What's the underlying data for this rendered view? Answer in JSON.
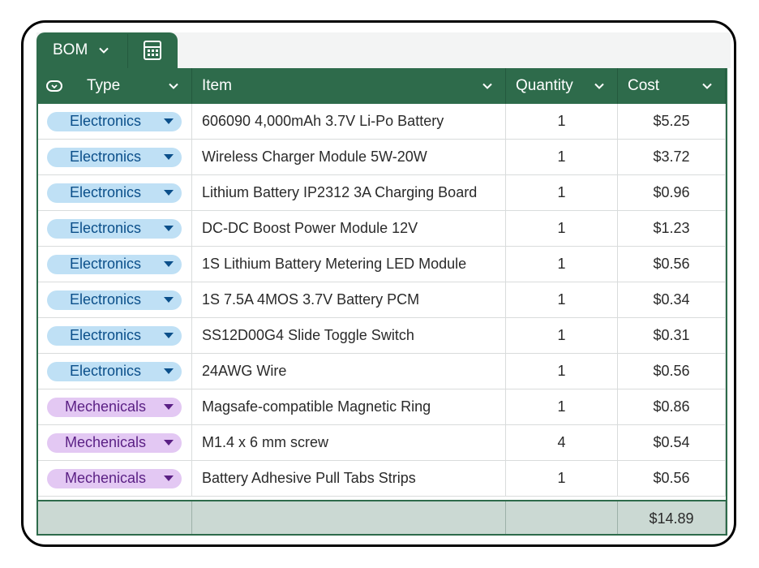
{
  "sheet_tab": {
    "label": "BOM",
    "menu_icon": "chevron-down-icon",
    "view_icon": "calculator-icon"
  },
  "colors": {
    "header_bg": "#2e6b4b",
    "electronics_chip": "#bfe0f5",
    "mechanicals_chip": "#e3c8f3",
    "footer_bg": "#cbd9d3"
  },
  "columns": {
    "type": "Type",
    "item": "Item",
    "quantity": "Quantity",
    "cost": "Cost"
  },
  "rows": [
    {
      "type": "Electronics",
      "item": "606090 4,000mAh 3.7V Li-Po Battery",
      "quantity": "1",
      "cost": "$5.25"
    },
    {
      "type": "Electronics",
      "item": "Wireless Charger Module 5W-20W",
      "quantity": "1",
      "cost": "$3.72"
    },
    {
      "type": "Electronics",
      "item": "Lithium Battery IP2312 3A Charging Board",
      "quantity": "1",
      "cost": "$0.96"
    },
    {
      "type": "Electronics",
      "item": "DC-DC Boost Power Module 12V",
      "quantity": "1",
      "cost": "$1.23"
    },
    {
      "type": "Electronics",
      "item": "1S Lithium Battery Metering LED Module",
      "quantity": "1",
      "cost": "$0.56"
    },
    {
      "type": "Electronics",
      "item": "1S 7.5A 4MOS 3.7V Battery PCM",
      "quantity": "1",
      "cost": "$0.34"
    },
    {
      "type": "Electronics",
      "item": "SS12D00G4 Slide Toggle Switch",
      "quantity": "1",
      "cost": "$0.31"
    },
    {
      "type": "Electronics",
      "item": "24AWG Wire",
      "quantity": "1",
      "cost": "$0.56"
    },
    {
      "type": "Mechenicals",
      "item": "Magsafe-compatible Magnetic Ring",
      "quantity": "1",
      "cost": "$0.86"
    },
    {
      "type": "Mechenicals",
      "item": "M1.4 x 6 mm screw",
      "quantity": "4",
      "cost": "$0.54"
    },
    {
      "type": "Mechenicals",
      "item": "Battery Adhesive Pull Tabs Strips",
      "quantity": "1",
      "cost": "$0.56"
    }
  ],
  "footer": {
    "total_cost": "$14.89"
  }
}
